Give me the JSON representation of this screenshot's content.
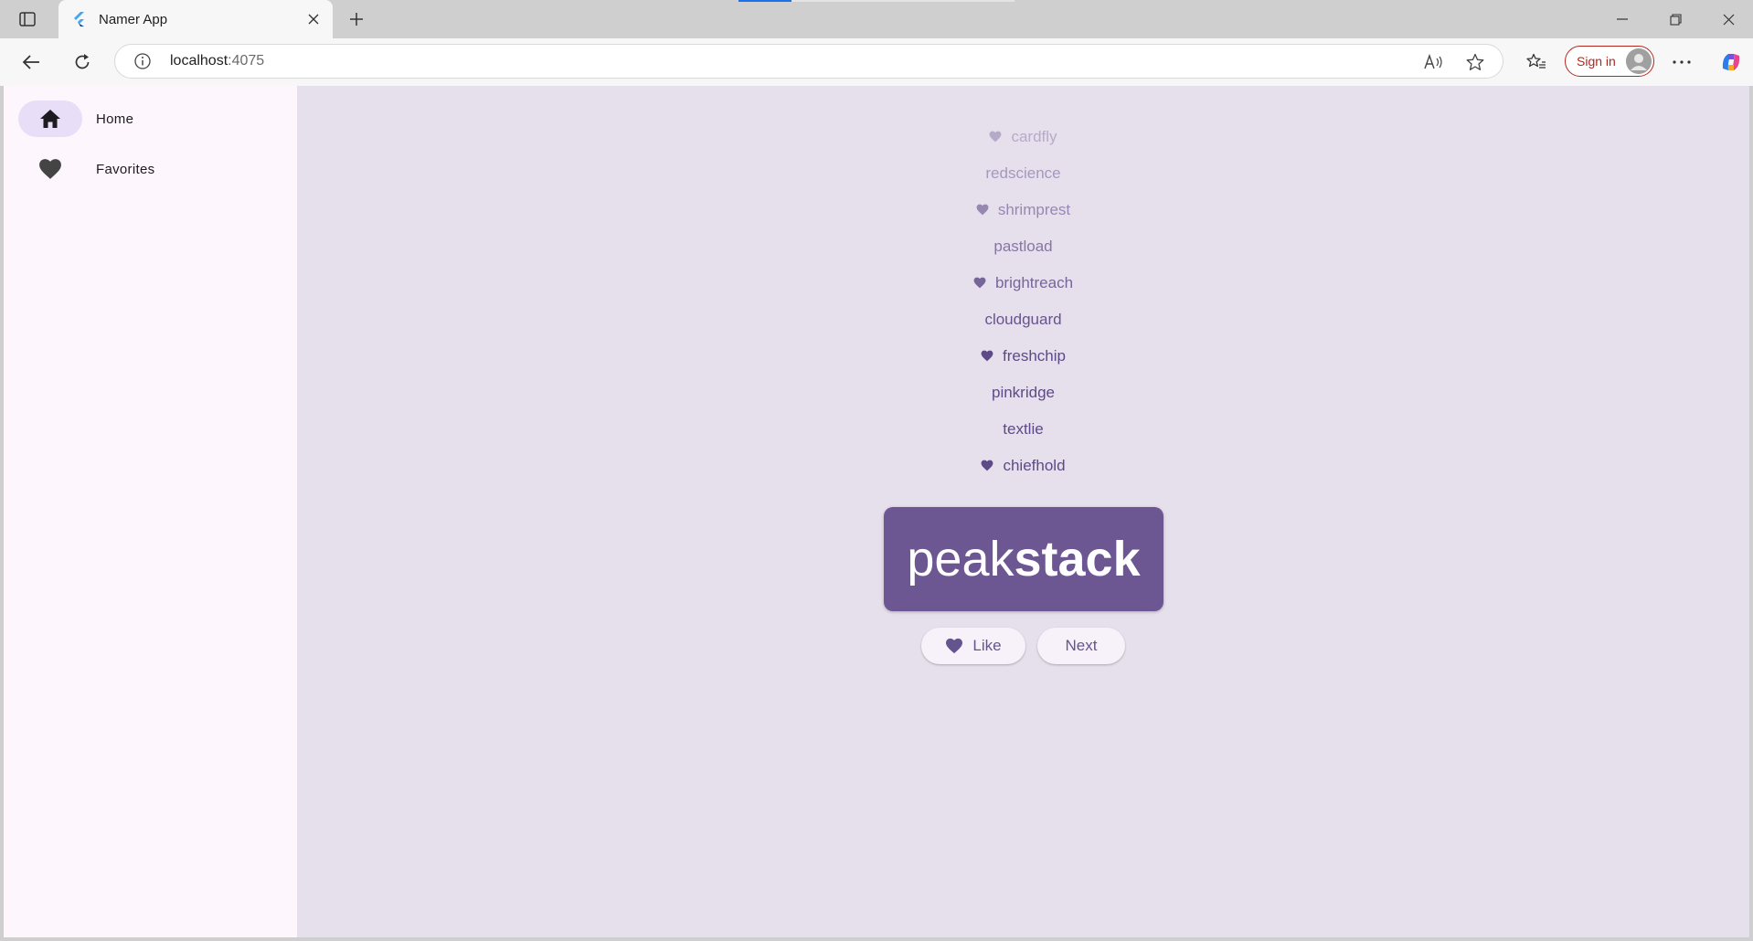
{
  "browser": {
    "tab_title": "Namer App",
    "url_host": "localhost",
    "url_port": ":4075",
    "signin_label": "Sign in"
  },
  "nav": {
    "items": [
      {
        "label": "Home",
        "icon": "home-icon",
        "selected": true
      },
      {
        "label": "Favorites",
        "icon": "heart-icon",
        "selected": false
      }
    ]
  },
  "history": [
    {
      "name": "cardfly",
      "favorite": true
    },
    {
      "name": "redscience",
      "favorite": false
    },
    {
      "name": "shrimprest",
      "favorite": true
    },
    {
      "name": "pastload",
      "favorite": false
    },
    {
      "name": "brightreach",
      "favorite": true
    },
    {
      "name": "cloudguard",
      "favorite": false
    },
    {
      "name": "freshchip",
      "favorite": true
    },
    {
      "name": "pinkridge",
      "favorite": false
    },
    {
      "name": "textlie",
      "favorite": false
    },
    {
      "name": "chiefhold",
      "favorite": true
    }
  ],
  "current_pair": {
    "first": "peak",
    "second": "stack"
  },
  "actions": {
    "like_label": "Like",
    "next_label": "Next"
  },
  "colors": {
    "primary": "#6c5792",
    "page_bg": "#e6dfec",
    "nav_bg": "#fdf7fd",
    "nav_indicator": "#e8def8"
  }
}
